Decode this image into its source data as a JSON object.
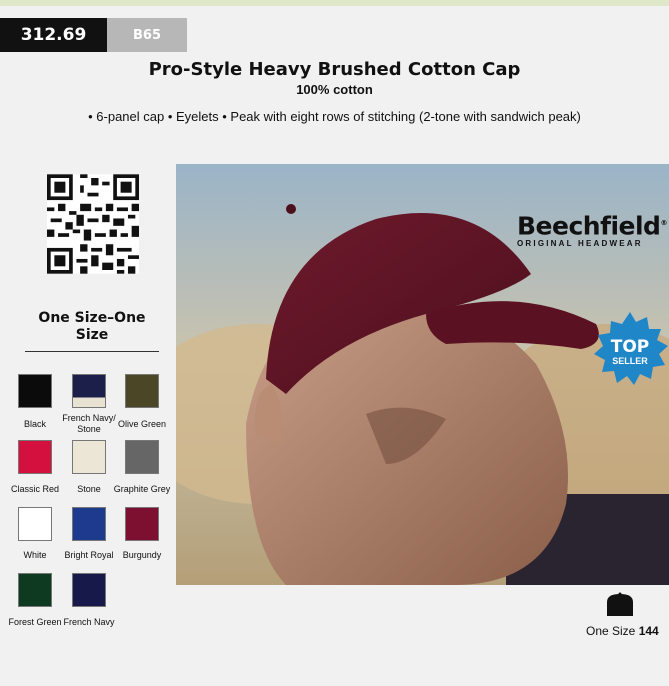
{
  "header": {
    "product_code": "312.69",
    "brand_ref": "B65"
  },
  "product": {
    "title": "Pro-Style Heavy Brushed Cotton Cap",
    "material": "100% cotton",
    "features": "• 6-panel cap • Eyelets • Peak with eight rows of stitching (2-tone with sandwich peak)"
  },
  "sizes": {
    "heading": "One Size–One Size",
    "size_label": "One Size",
    "size_count": "144"
  },
  "brand": {
    "name": "Beechfield",
    "tagline": "ORIGINAL HEADWEAR",
    "registered": "®"
  },
  "badge": {
    "line1": "TOP",
    "line2": "SELLER",
    "color": "#1f86c8"
  },
  "colours": [
    {
      "name": "Black",
      "hex": "#0b0b0b"
    },
    {
      "name": "French Navy/ Stone",
      "hex": "#1b1f4a",
      "hex2": "#e8e2d2"
    },
    {
      "name": "Olive Green",
      "hex": "#4a4626"
    },
    {
      "name": "Classic Red",
      "hex": "#d3103e"
    },
    {
      "name": "Stone",
      "hex": "#ece6d6"
    },
    {
      "name": "Graphite Grey",
      "hex": "#666666"
    },
    {
      "name": "White",
      "hex": "#ffffff"
    },
    {
      "name": "Bright Royal",
      "hex": "#1d3a8e"
    },
    {
      "name": "Burgundy",
      "hex": "#7d0f31"
    },
    {
      "name": "Forest Green",
      "hex": "#0d3a20"
    },
    {
      "name": "French Navy",
      "hex": "#17194a"
    }
  ]
}
